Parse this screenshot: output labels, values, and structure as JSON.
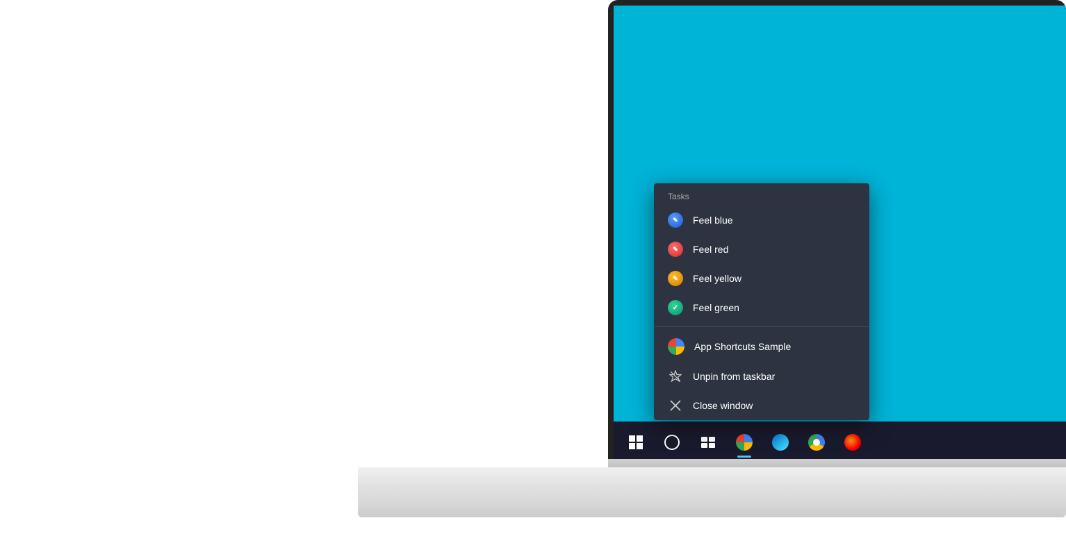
{
  "context_menu": {
    "section_label": "Tasks",
    "items": [
      {
        "id": "feel-blue",
        "label": "Feel blue",
        "icon_type": "blue",
        "icon_char": "✏"
      },
      {
        "id": "feel-red",
        "label": "Feel red",
        "icon_type": "red",
        "icon_char": "✏"
      },
      {
        "id": "feel-yellow",
        "label": "Feel yellow",
        "icon_type": "yellow",
        "icon_char": "✏"
      },
      {
        "id": "feel-green",
        "label": "Feel green",
        "icon_type": "green",
        "icon_char": "✓"
      }
    ],
    "app_name": "App Shortcuts Sample",
    "unpin_label": "Unpin from taskbar",
    "close_label": "Close window"
  },
  "taskbar": {
    "icons": [
      {
        "id": "start",
        "label": "Start"
      },
      {
        "id": "search",
        "label": "Search"
      },
      {
        "id": "task-view",
        "label": "Task View"
      },
      {
        "id": "app-shortcuts",
        "label": "App Shortcuts Sample",
        "active": true
      },
      {
        "id": "edge",
        "label": "Microsoft Edge"
      },
      {
        "id": "chrome",
        "label": "Google Chrome"
      },
      {
        "id": "firefox",
        "label": "Mozilla Firefox"
      }
    ]
  },
  "colors": {
    "desktop_bg": "#00b4d8",
    "taskbar_bg": "#1a1a2e",
    "context_menu_bg": "#2d3340",
    "active_indicator": "#4fc3f7"
  }
}
